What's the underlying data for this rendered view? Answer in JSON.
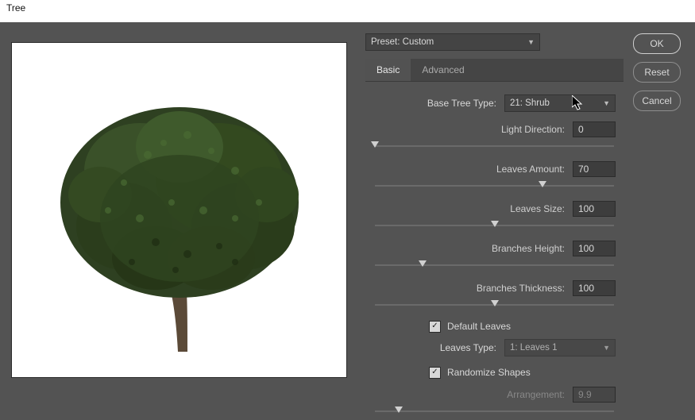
{
  "window": {
    "title": "Tree"
  },
  "preset": {
    "label_prefix": "Preset: ",
    "value": "Custom"
  },
  "tabs": {
    "basic": "Basic",
    "advanced": "Advanced",
    "active": "basic"
  },
  "base_tree_type": {
    "label": "Base Tree Type:",
    "value": "21: Shrub"
  },
  "light_direction": {
    "label": "Light Direction:",
    "value": "0",
    "slider_pct": 0
  },
  "leaves_amount": {
    "label": "Leaves Amount:",
    "value": "70",
    "slider_pct": 70
  },
  "leaves_size": {
    "label": "Leaves Size:",
    "value": "100",
    "slider_pct": 50
  },
  "branches_height": {
    "label": "Branches Height:",
    "value": "100",
    "slider_pct": 20
  },
  "branches_thickness": {
    "label": "Branches Thickness:",
    "value": "100",
    "slider_pct": 50
  },
  "default_leaves": {
    "label": "Default Leaves",
    "checked": true
  },
  "leaves_type": {
    "label": "Leaves Type:",
    "value": "1: Leaves 1",
    "disabled": true
  },
  "randomize_shapes": {
    "label": "Randomize Shapes",
    "checked": true
  },
  "arrangement": {
    "label": "Arrangement:",
    "value": "9.9",
    "disabled": true,
    "slider_pct": 10
  },
  "buttons": {
    "ok": "OK",
    "reset": "Reset",
    "cancel": "Cancel"
  }
}
